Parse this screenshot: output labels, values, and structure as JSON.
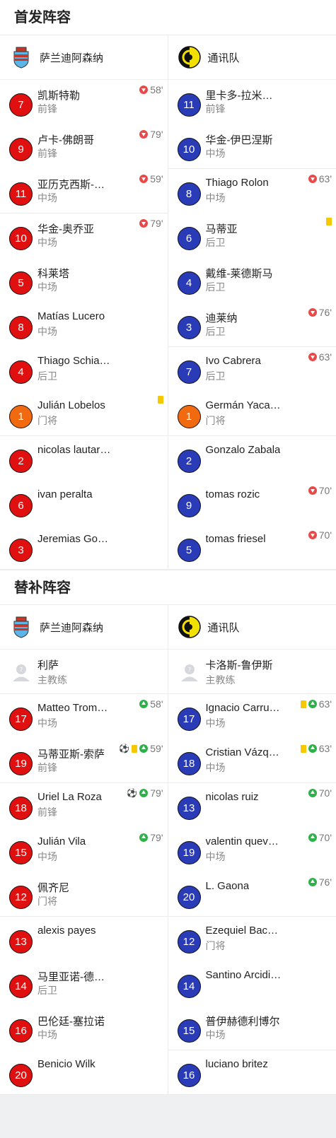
{
  "starting": {
    "title": "首发阵容",
    "home_team": "萨兰迪阿森纳",
    "away_team": "通讯队",
    "rows": [
      {
        "home": {
          "num": "7",
          "color": "red",
          "name": "凯斯特勒",
          "pos": "前锋",
          "events": [
            {
              "type": "out",
              "min": "58'"
            }
          ]
        },
        "away": {
          "num": "11",
          "color": "blue",
          "name": "里卡多-拉米…",
          "pos": "前锋",
          "events": []
        }
      },
      {
        "home": {
          "num": "9",
          "color": "red",
          "name": "卢卡-佛朗哥",
          "pos": "前锋",
          "events": [
            {
              "type": "out",
              "min": "79'"
            }
          ]
        },
        "away": {
          "num": "10",
          "color": "blue",
          "name": "华金-伊巴涅斯",
          "pos": "中场",
          "events": []
        }
      },
      {
        "home": {
          "num": "11",
          "color": "red",
          "name": "亚历克西斯-…",
          "pos": "中场",
          "events": [
            {
              "type": "out",
              "min": "59'"
            }
          ]
        },
        "away": {
          "num": "8",
          "color": "blue",
          "name": "Thiago Rolon",
          "pos": "中场",
          "events": [
            {
              "type": "out",
              "min": "63'"
            }
          ]
        }
      },
      {
        "home": {
          "num": "10",
          "color": "red",
          "name": "华金-奥乔亚",
          "pos": "中场",
          "events": [
            {
              "type": "out",
              "min": "79'"
            }
          ]
        },
        "away": {
          "num": "6",
          "color": "blue",
          "name": "马蒂亚",
          "pos": "后卫",
          "events": [
            {
              "type": "yellow",
              "min": ""
            }
          ]
        }
      },
      {
        "home": {
          "num": "5",
          "color": "red",
          "name": "科莱塔",
          "pos": "中场",
          "events": []
        },
        "away": {
          "num": "4",
          "color": "blue",
          "name": "戴维-莱德斯马",
          "pos": "后卫",
          "events": []
        }
      },
      {
        "home": {
          "num": "8",
          "color": "red",
          "name": "Matías Lucero",
          "pos": "中场",
          "events": []
        },
        "away": {
          "num": "3",
          "color": "blue",
          "name": "迪莱纳",
          "pos": "后卫",
          "events": [
            {
              "type": "out",
              "min": "76'"
            }
          ]
        }
      },
      {
        "home": {
          "num": "4",
          "color": "red",
          "name": "Thiago Schia…",
          "pos": "后卫",
          "events": []
        },
        "away": {
          "num": "7",
          "color": "blue",
          "name": "Ivo Cabrera",
          "pos": "后卫",
          "events": [
            {
              "type": "out",
              "min": "63'"
            }
          ]
        }
      },
      {
        "home": {
          "num": "1",
          "color": "orange",
          "name": "Julián Lobelos",
          "pos": "门将",
          "events": [
            {
              "type": "yellow",
              "min": ""
            }
          ]
        },
        "away": {
          "num": "1",
          "color": "orange",
          "name": "Germán Yaca…",
          "pos": "门将",
          "events": []
        }
      },
      {
        "home": {
          "num": "2",
          "color": "red",
          "name": "nicolas lautar…",
          "pos": "",
          "events": []
        },
        "away": {
          "num": "2",
          "color": "blue",
          "name": "Gonzalo Zabala",
          "pos": "",
          "events": []
        }
      },
      {
        "home": {
          "num": "6",
          "color": "red",
          "name": "ivan peralta",
          "pos": "",
          "events": []
        },
        "away": {
          "num": "9",
          "color": "blue",
          "name": "tomas rozic",
          "pos": "",
          "events": [
            {
              "type": "out",
              "min": "70'"
            }
          ]
        }
      },
      {
        "home": {
          "num": "3",
          "color": "red",
          "name": "Jeremias Go…",
          "pos": "",
          "events": []
        },
        "away": {
          "num": "5",
          "color": "blue",
          "name": "tomas friesel",
          "pos": "",
          "events": [
            {
              "type": "out",
              "min": "70'"
            }
          ]
        }
      }
    ]
  },
  "subs": {
    "title": "替补阵容",
    "home_team": "萨兰迪阿森纳",
    "away_team": "通讯队",
    "home_coach": {
      "name": "利萨",
      "role": "主教练"
    },
    "away_coach": {
      "name": "卡洛斯-鲁伊斯",
      "role": "主教练"
    },
    "rows": [
      {
        "home": {
          "num": "17",
          "color": "red",
          "name": "Matteo Trombini",
          "pos": "中场",
          "events": [
            {
              "type": "in",
              "min": "58'"
            }
          ]
        },
        "away": {
          "num": "17",
          "color": "blue",
          "name": "Ignacio Carru…",
          "pos": "中场",
          "events": [
            {
              "type": "yellow",
              "min": ""
            },
            {
              "type": "in",
              "min": "63'"
            }
          ]
        }
      },
      {
        "home": {
          "num": "19",
          "color": "red",
          "name": "马蒂亚斯-索萨",
          "pos": "前锋",
          "events": [
            {
              "type": "goal",
              "min": ""
            },
            {
              "type": "yellow",
              "min": ""
            },
            {
              "type": "in",
              "min": "59'"
            }
          ]
        },
        "away": {
          "num": "18",
          "color": "blue",
          "name": "Cristian Vázq…",
          "pos": "中场",
          "events": [
            {
              "type": "yellow",
              "min": ""
            },
            {
              "type": "in",
              "min": "63'"
            }
          ]
        }
      },
      {
        "home": {
          "num": "18",
          "color": "red",
          "name": "Uriel La Roza",
          "pos": "前锋",
          "events": [
            {
              "type": "goal",
              "min": ""
            },
            {
              "type": "in",
              "min": "79'"
            }
          ]
        },
        "away": {
          "num": "13",
          "color": "blue",
          "name": "nicolas ruiz",
          "pos": "",
          "events": [
            {
              "type": "in",
              "min": "70'"
            }
          ]
        }
      },
      {
        "home": {
          "num": "15",
          "color": "red",
          "name": "Julián Vila",
          "pos": "中场",
          "events": [
            {
              "type": "in",
              "min": "79'"
            }
          ]
        },
        "away": {
          "num": "19",
          "color": "blue",
          "name": "valentin quev…",
          "pos": "中场",
          "events": [
            {
              "type": "in",
              "min": "70'"
            }
          ]
        }
      },
      {
        "home": {
          "num": "12",
          "color": "red",
          "name": "佩齐尼",
          "pos": "门将",
          "events": []
        },
        "away": {
          "num": "20",
          "color": "blue",
          "name": "L. Gaona",
          "pos": "",
          "events": [
            {
              "type": "in",
              "min": "76'"
            }
          ]
        }
      },
      {
        "home": {
          "num": "13",
          "color": "red",
          "name": "alexis payes",
          "pos": "",
          "events": []
        },
        "away": {
          "num": "12",
          "color": "blue",
          "name": "Ezequiel Bac…",
          "pos": "门将",
          "events": []
        }
      },
      {
        "home": {
          "num": "14",
          "color": "red",
          "name": "马里亚诺-德…",
          "pos": "后卫",
          "events": []
        },
        "away": {
          "num": "14",
          "color": "blue",
          "name": "Santino Arcidi…",
          "pos": "",
          "events": []
        }
      },
      {
        "home": {
          "num": "16",
          "color": "red",
          "name": "巴伦廷-塞拉诺",
          "pos": "中场",
          "events": []
        },
        "away": {
          "num": "15",
          "color": "blue",
          "name": "普伊赫德利博尔",
          "pos": "中场",
          "events": []
        }
      },
      {
        "home": {
          "num": "20",
          "color": "red",
          "name": "Benicio Wilk",
          "pos": "",
          "events": []
        },
        "away": {
          "num": "16",
          "color": "blue",
          "name": "luciano britez",
          "pos": "",
          "events": []
        }
      }
    ]
  }
}
